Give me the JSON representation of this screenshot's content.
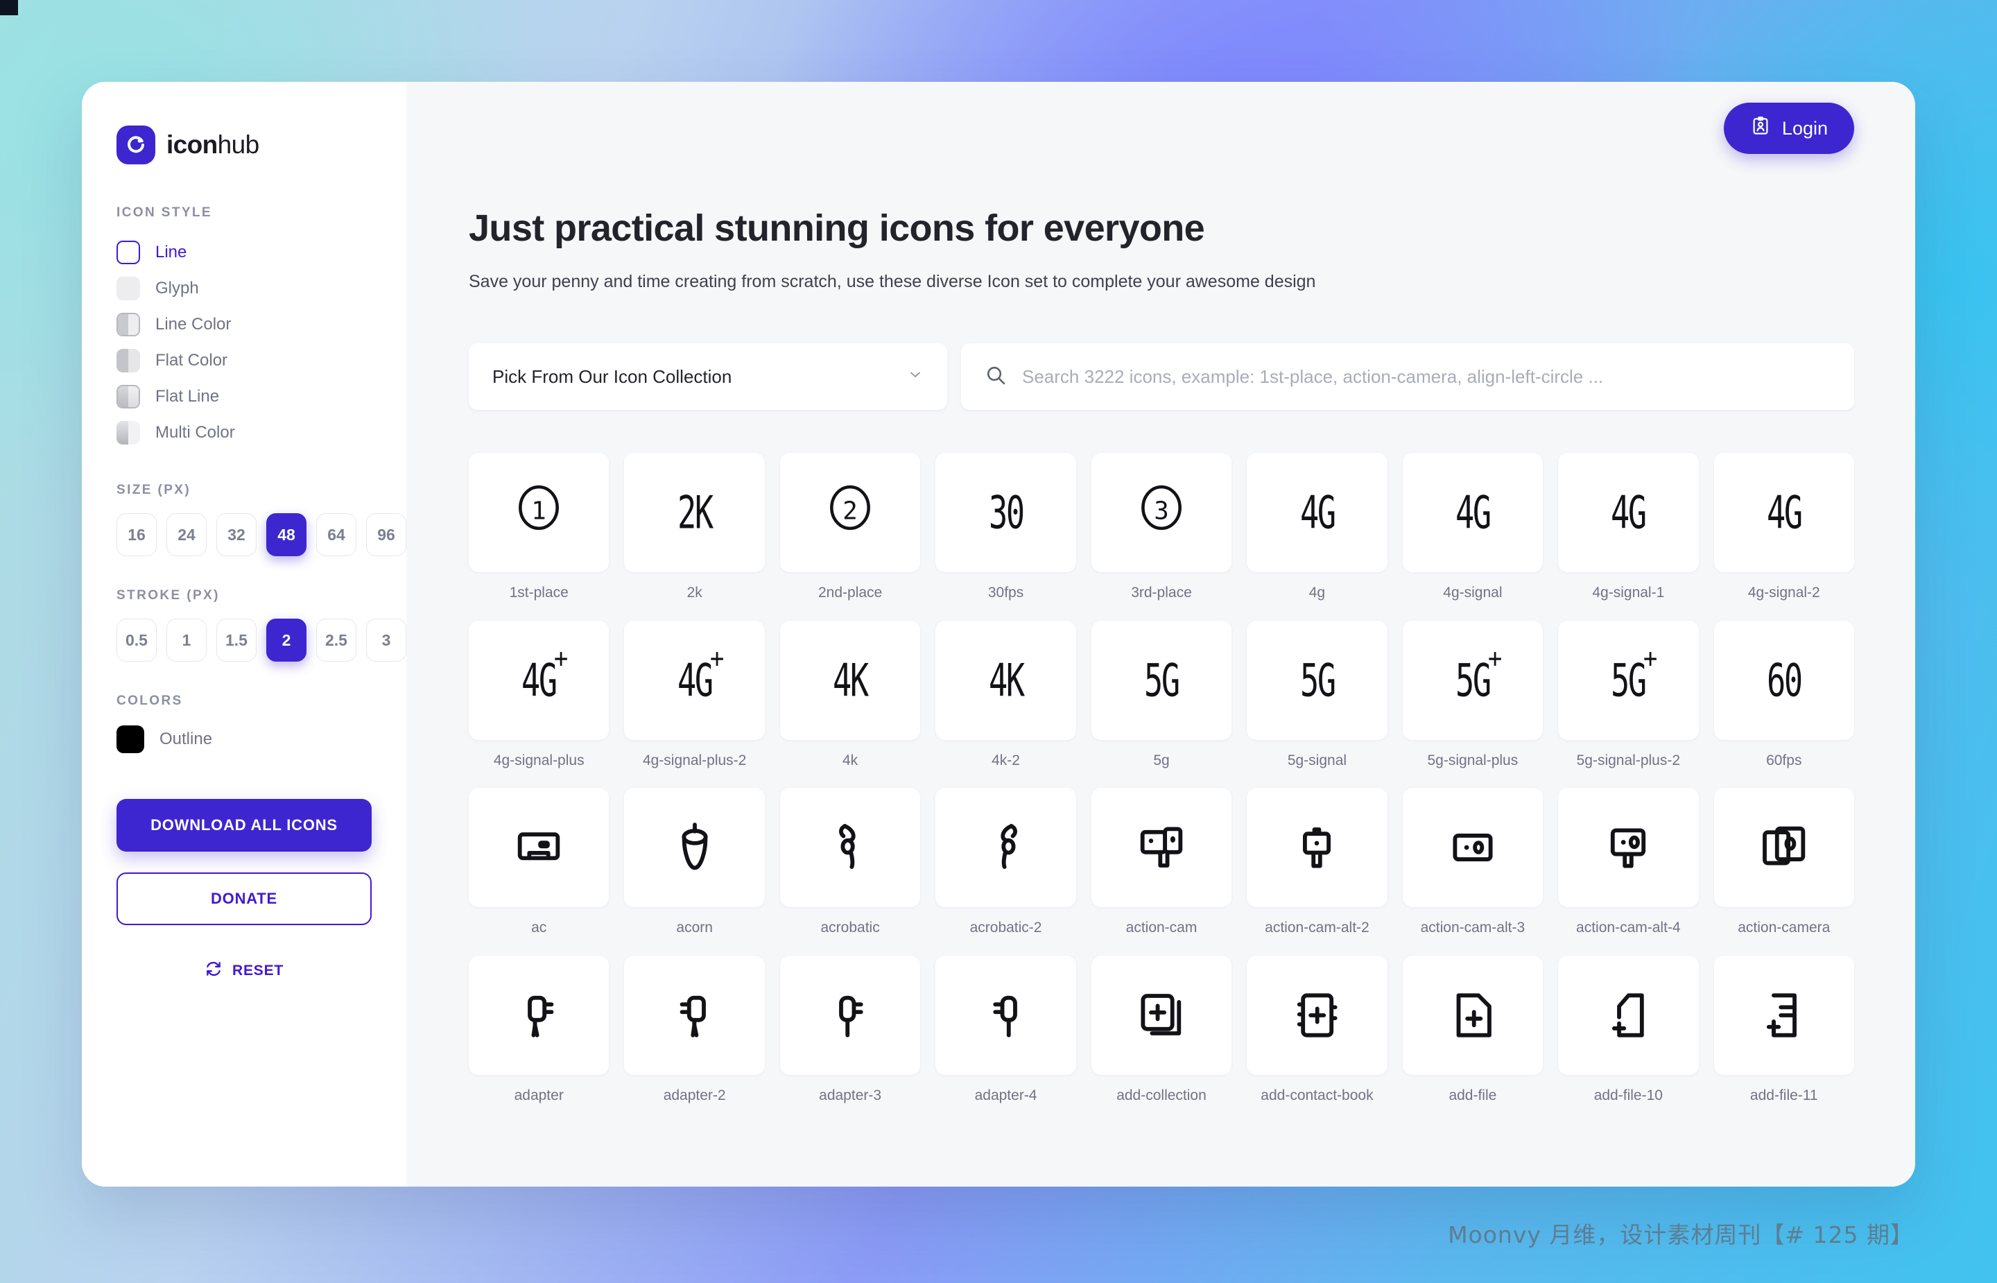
{
  "brand": {
    "name_bold": "icon",
    "name_light": "hub",
    "logo_icon": "iconhub-logo-icon",
    "accent_color": "#3d26cf",
    "accent_text_color": "#4218d4"
  },
  "sidebar": {
    "icon_style": {
      "label": "ICON STYLE",
      "items": [
        {
          "label": "Line",
          "active": true,
          "swatch": "sw-line"
        },
        {
          "label": "Glyph",
          "active": false,
          "swatch": "sw-glyph"
        },
        {
          "label": "Line Color",
          "active": false,
          "swatch": "sw-linecolor"
        },
        {
          "label": "Flat Color",
          "active": false,
          "swatch": "sw-flatcolor"
        },
        {
          "label": "Flat Line",
          "active": false,
          "swatch": "sw-flatline"
        },
        {
          "label": "Multi Color",
          "active": false,
          "swatch": "sw-multicolor"
        }
      ]
    },
    "size": {
      "label": "SIZE (PX)",
      "options": [
        "16",
        "24",
        "32",
        "48",
        "64",
        "96"
      ],
      "selected": "48"
    },
    "stroke": {
      "label": "STROKE (PX)",
      "options": [
        "0.5",
        "1",
        "1.5",
        "2",
        "2.5",
        "3"
      ],
      "selected": "2"
    },
    "colors": {
      "label": "COLORS",
      "swatch_color": "#000000",
      "swatch_name": "Outline"
    },
    "download_label": "DOWNLOAD ALL ICONS",
    "donate_label": "DONATE",
    "reset_label": "RESET",
    "reset_icon": "refresh-icon"
  },
  "header": {
    "login_label": "Login",
    "login_icon": "id-card-icon",
    "title": "Just practical stunning icons for everyone",
    "subtitle": "Save your penny and time creating from scratch, use these diverse Icon set to complete your awesome design"
  },
  "controls": {
    "collection_select_value": "Pick From Our Icon Collection",
    "chevron_icon": "chevron-down-icon",
    "search_icon": "search-icon",
    "search_value": "",
    "search_placeholder": "Search 3222 icons, example: 1st-place, action-camera, align-left-circle ..."
  },
  "icons": [
    {
      "label": "1st-place",
      "kind": "circle",
      "text": "1"
    },
    {
      "label": "2k",
      "kind": "text",
      "text": "2K"
    },
    {
      "label": "2nd-place",
      "kind": "circle",
      "text": "2"
    },
    {
      "label": "30fps",
      "kind": "text",
      "text": "30"
    },
    {
      "label": "3rd-place",
      "kind": "circle",
      "text": "3"
    },
    {
      "label": "4g",
      "kind": "text",
      "text": "4G"
    },
    {
      "label": "4g-signal",
      "kind": "text",
      "text": "4G"
    },
    {
      "label": "4g-signal-1",
      "kind": "text",
      "text": "4G"
    },
    {
      "label": "4g-signal-2",
      "kind": "text",
      "text": "4G"
    },
    {
      "label": "4g-signal-plus",
      "kind": "text-plus",
      "text": "4G"
    },
    {
      "label": "4g-signal-plus-2",
      "kind": "text-plus",
      "text": "4G"
    },
    {
      "label": "4k",
      "kind": "text",
      "text": "4K"
    },
    {
      "label": "4k-2",
      "kind": "text",
      "text": "4K"
    },
    {
      "label": "5g",
      "kind": "text",
      "text": "5G"
    },
    {
      "label": "5g-signal",
      "kind": "text",
      "text": "5G"
    },
    {
      "label": "5g-signal-plus",
      "kind": "text-plus",
      "text": "5G"
    },
    {
      "label": "5g-signal-plus-2",
      "kind": "text-plus",
      "text": "5G"
    },
    {
      "label": "60fps",
      "kind": "text",
      "text": "60"
    },
    {
      "label": "ac",
      "kind": "svg",
      "svg": "ac"
    },
    {
      "label": "acorn",
      "kind": "svg",
      "svg": "acorn"
    },
    {
      "label": "acrobatic",
      "kind": "svg",
      "svg": "acrobatic"
    },
    {
      "label": "acrobatic-2",
      "kind": "svg",
      "svg": "acrobatic2"
    },
    {
      "label": "action-cam",
      "kind": "svg",
      "svg": "actioncam"
    },
    {
      "label": "action-cam-alt-2",
      "kind": "svg",
      "svg": "actioncamalt2"
    },
    {
      "label": "action-cam-alt-3",
      "kind": "svg",
      "svg": "actioncamalt3"
    },
    {
      "label": "action-cam-alt-4",
      "kind": "svg",
      "svg": "actioncamalt4"
    },
    {
      "label": "action-camera",
      "kind": "svg",
      "svg": "actioncamera"
    },
    {
      "label": "adapter",
      "kind": "svg",
      "svg": "adapter"
    },
    {
      "label": "adapter-2",
      "kind": "svg",
      "svg": "adapter2"
    },
    {
      "label": "adapter-3",
      "kind": "svg",
      "svg": "adapter3"
    },
    {
      "label": "adapter-4",
      "kind": "svg",
      "svg": "adapter4"
    },
    {
      "label": "add-collection",
      "kind": "svg",
      "svg": "addcollection"
    },
    {
      "label": "add-contact-book",
      "kind": "svg",
      "svg": "addcontactbook"
    },
    {
      "label": "add-file",
      "kind": "svg",
      "svg": "addfile"
    },
    {
      "label": "add-file-10",
      "kind": "svg",
      "svg": "addfile10"
    },
    {
      "label": "add-file-11",
      "kind": "svg",
      "svg": "addfile11"
    }
  ],
  "watermark": "Moonvy 月维，设计素材周刊【# 125 期】"
}
